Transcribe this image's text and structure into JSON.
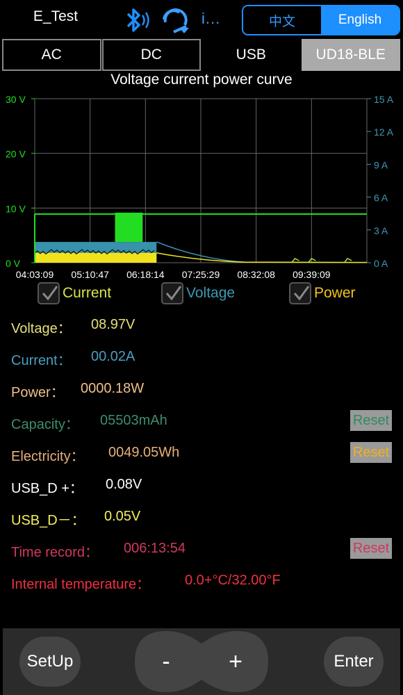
{
  "header": {
    "title": "E_Test",
    "info_label": "i...",
    "lang_cn": "中文",
    "lang_en": "English",
    "icons": [
      "bluetooth-icon",
      "sync-icon"
    ]
  },
  "tabs": [
    {
      "label": "AC",
      "active": false
    },
    {
      "label": "DC",
      "active": false
    },
    {
      "label": "USB",
      "active": false
    },
    {
      "label": "UD18-BLE",
      "active": true
    }
  ],
  "chart_title": "Voltage current power curve",
  "chart_data": {
    "type": "line",
    "title": "Voltage current power curve",
    "x": [
      "04:03:09",
      "05:10:47",
      "06:18:14",
      "07:25:29",
      "08:32:08",
      "09:39:09"
    ],
    "left_axis": {
      "ticks": [
        "30 V",
        "20 V",
        "10 V",
        "0 V"
      ],
      "ylim": [
        0,
        30
      ],
      "unit": "V"
    },
    "right_axis": {
      "ticks": [
        "15 A",
        "12 A",
        "9 A",
        "6 A",
        "3 A",
        "0 A"
      ],
      "ylim": [
        0,
        15
      ],
      "unit": "A"
    },
    "grid": true,
    "series": [
      {
        "name": "Voltage",
        "color": "#22dd22",
        "values": [
          8.9,
          8.9,
          8.9,
          8.9,
          8.9,
          8.9
        ]
      },
      {
        "name": "Current",
        "color": "#3b9ab5",
        "values": [
          1.7,
          1.7,
          1.9,
          0.1,
          0.05,
          0.02
        ]
      },
      {
        "name": "Power",
        "color": "#f2e21b",
        "values": [
          0.4,
          0.4,
          0.9,
          0.05,
          0.05,
          0.02
        ]
      }
    ],
    "colors": {
      "voltage": "#22dd22",
      "current": "#3b9ab5",
      "power": "#f2e21b",
      "grid": "#666666",
      "left_ticks": "#22dd22",
      "right_ticks": "#3b9ab5"
    }
  },
  "legend": {
    "current": "Current",
    "voltage": "Voltage",
    "power": "Power"
  },
  "readings": {
    "voltage_label": "Voltage：",
    "voltage_value": "08.97V",
    "current_label": "Current：",
    "current_value": "00.02A",
    "power_label": "Power：",
    "power_value": "0000.18W",
    "capacity_label": "Capacity：",
    "capacity_value": "05503mAh",
    "capacity_reset": "Reset",
    "electricity_label": "Electricity：",
    "electricity_value": "0049.05Wh",
    "electricity_reset": "Reset",
    "usb_dp_label": "USB_D +：",
    "usb_dp_value": "0.08V",
    "usb_dm_label": "USB_D－：",
    "usb_dm_value": "0.05V",
    "time_label": "Time record：",
    "time_value": "006:13:54",
    "time_reset": "Reset",
    "temp_label": "Internal temperature：",
    "temp_value": "0.0+°C/32.00°F"
  },
  "bottom": {
    "setup": "SetUp",
    "minus": "-",
    "plus": "+",
    "enter": "Enter"
  }
}
